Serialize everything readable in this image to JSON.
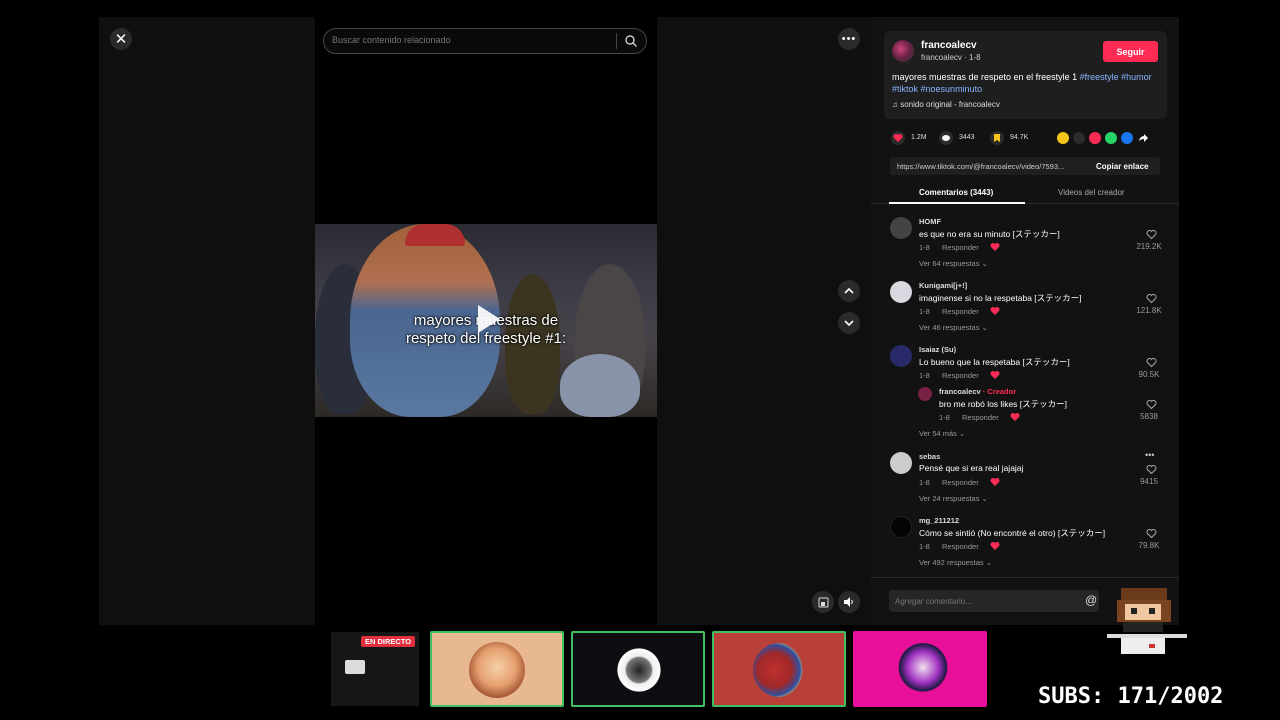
{
  "search": {
    "placeholder": "Buscar contenido relacionado"
  },
  "video": {
    "caption_line1": "mayores muestras de",
    "caption_line2": "respeto del freestyle #1:"
  },
  "author": {
    "name": "francoalecv",
    "sub": "francoalecv · 1-8",
    "follow_label": "Seguir"
  },
  "description": {
    "text": "mayores muestras de respeto en el freestyle 1 ",
    "tags": [
      "#freestyle",
      "#humor",
      "#tiktok",
      "#noesunminuto"
    ]
  },
  "sound": {
    "label": "♫ sonido original - francoalecv"
  },
  "stats": {
    "likes": "1.2M",
    "comments": "3443",
    "saves": "94.7K"
  },
  "link": {
    "url": "https://www.tiktok.com/@francoalecv/video/7593...",
    "copy_label": "Copiar enlace"
  },
  "tabs": {
    "comments": "Comentarios (3443)",
    "videos": "Videos del creador"
  },
  "comments": [
    {
      "user": "HOMF",
      "text": "es que no era su minuto [ステッカー]",
      "date": "1-8",
      "reply": "Responder",
      "replies": "Ver 64 respuestas",
      "likes": "219.2K"
    },
    {
      "user": "Kunigami[j+!]",
      "text": "imaginense si no la respetaba [ステッカー]",
      "date": "1-8",
      "reply": "Responder",
      "replies": "Ver 46 respuestas",
      "likes": "121.8K"
    },
    {
      "user": "Isaiaz (Su)",
      "text": "Lo bueno que la respetaba [ステッカー]",
      "date": "1-8",
      "reply": "Responder",
      "replies": "Ver 54 más",
      "likes": "90.5K"
    },
    {
      "user": "sebas",
      "text": "Pensé que si era real jajajaj",
      "date": "1-8",
      "reply": "Responder",
      "replies": "Ver 24 respuestas",
      "likes": "9415"
    },
    {
      "user": "mg_211212",
      "text": "Cómo se sintió (No encontré el otro) [ステッカー]",
      "date": "1-8",
      "reply": "Responder",
      "replies": "Ver 492 respuestas",
      "likes": "79.8K"
    }
  ],
  "reply": {
    "user": "francoalecv",
    "creator": " · Creador",
    "text": "bro me robó los likes [ステッカー]",
    "date": "1-8",
    "reply": "Responder",
    "likes": "5838"
  },
  "comment_input": {
    "placeholder": "Agregar comentario..."
  },
  "stream": {
    "live_label": "EN DIRECTO",
    "subs": "SUBS: 171/2002"
  },
  "colors": {
    "accent": "#fe2c55",
    "tag": "#8ab4ff",
    "cam_border": "#40c060"
  }
}
